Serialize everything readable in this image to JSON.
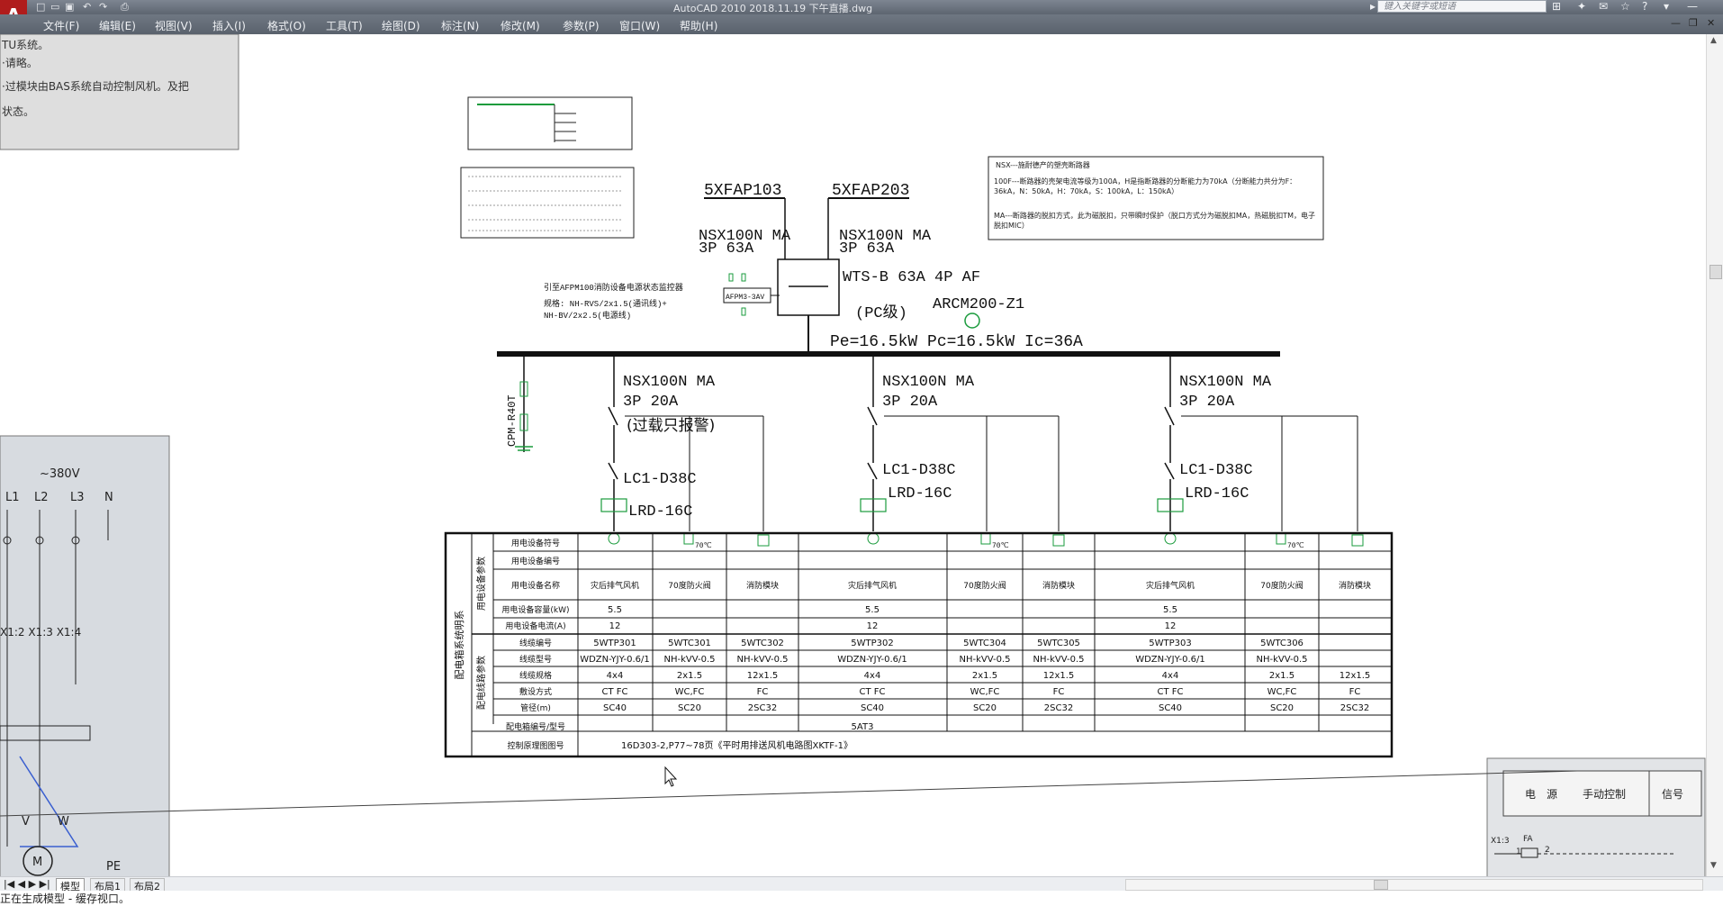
{
  "app": {
    "logo": "A",
    "title": "AutoCAD 2010    2018.11.19 下午直播.dwg",
    "search_placeholder": "键入关键字或短语",
    "quick_access": [
      "□",
      "▭",
      "▣",
      "↶",
      "↷",
      "⎙"
    ]
  },
  "menu": [
    "文件(F)",
    "编辑(E)",
    "视图(V)",
    "插入(I)",
    "格式(O)",
    "工具(T)",
    "绘图(D)",
    "标注(N)",
    "修改(M)",
    "参数(P)",
    "窗口(W)",
    "帮助(H)"
  ],
  "overlay_topleft": [
    "TU系统。",
    "·请略。",
    "·过模块由BAS系统自动控制风机。及把",
    "状态。"
  ],
  "overlay_left": {
    "voltage": "~380V",
    "phases": [
      "L1",
      "L2",
      "L3",
      "N"
    ],
    "terminals": "X1:2 X1:3 X1:4",
    "motor": "M",
    "labels": [
      "V",
      "W",
      "PE"
    ]
  },
  "overlay_bottomright": {
    "headers": [
      "电　源",
      "手动控制",
      "信号"
    ],
    "labels": [
      "X1:3",
      "FA",
      "1",
      "2"
    ]
  },
  "schematic": {
    "sources": [
      "5XFAP103",
      "5XFAP203"
    ],
    "breakers_top": [
      "NSX100N MA",
      "3P 63A"
    ],
    "ats": "WTS-B 63A 4P AF",
    "pc_level": "(PC级)",
    "meter": "ARCM200-Z1",
    "power": "Pe=16.5kW  Pc=16.5kW  Ic=36A",
    "afpm_note": [
      "引至AFPM100消防设备电源状态监控器",
      "规格: NH-RVS/2x1.5(通讯线)+",
      "NH-BV/2x2.5(电源线)"
    ],
    "afpm_box": "AFPM3-3AV",
    "surge": "CPM-R40T",
    "branch_breaker": [
      "NSX100N MA",
      "3P 20A"
    ],
    "alarm_note": "(过载只报警)",
    "contactor": "LC1-D38C",
    "relay": "LRD-16C",
    "temp_tag": "70℃",
    "nsx_note": {
      "line1": "NSX---施耐德产的塑壳断路器",
      "line2": "100F---断路器的壳架电流等级为100A，H是指断路器的分断能力为70kA（分断能力共分为F：36kA，N：50kA，H：70kA，S：100kA，L：150kA）",
      "line3": "MA---断路器的脱扣方式，此为磁脱扣，只带瞬时保护（脱口方式分为磁脱扣MA，热磁脱扣TM，电子脱扣MIC）"
    }
  },
  "table": {
    "side_title": "配电箱系统明系",
    "group1": "用电设备参数",
    "group2": "配电线路参数",
    "row_labels": [
      "用电设备符号",
      "用电设备编号",
      "用电设备名称",
      "用电设备容量(kW)",
      "用电设备电流(A)",
      "线缆编号",
      "线缆型号",
      "线缆规格",
      "敷设方式",
      "管径(m)",
      "配电箱编号/型号",
      "控制原理图图号"
    ],
    "columns": [
      {
        "name": "灾后排气风机",
        "kw": "5.5",
        "a": "12",
        "cable_no": "5WTP301",
        "cable_type": "WDZN-YJY-0.6/1",
        "spec": "4x4",
        "lay": "CT FC",
        "pipe": "SC40"
      },
      {
        "name": "70度防火阀",
        "kw": "",
        "a": "",
        "cable_no": "5WTC301",
        "cable_type": "NH-kVV-0.5",
        "spec": "2x1.5",
        "lay": "WC,FC",
        "pipe": "SC20"
      },
      {
        "name": "消防模块",
        "kw": "",
        "a": "",
        "cable_no": "5WTC302",
        "cable_type": "NH-kVV-0.5",
        "spec": "12x1.5",
        "lay": "FC",
        "pipe": "2SC32"
      },
      {
        "name": "灾后排气风机",
        "kw": "5.5",
        "a": "12",
        "cable_no": "5WTP302",
        "cable_type": "WDZN-YJY-0.6/1",
        "spec": "4x4",
        "lay": "CT FC",
        "pipe": "SC40"
      },
      {
        "name": "70度防火阀",
        "kw": "",
        "a": "",
        "cable_no": "5WTC304",
        "cable_type": "NH-kVV-0.5",
        "spec": "2x1.5",
        "lay": "WC,FC",
        "pipe": "SC20"
      },
      {
        "name": "消防模块",
        "kw": "",
        "a": "",
        "cable_no": "5WTC305",
        "cable_type": "NH-kVV-0.5",
        "spec": "12x1.5",
        "lay": "FC",
        "pipe": "2SC32"
      },
      {
        "name": "灾后排气风机",
        "kw": "5.5",
        "a": "12",
        "cable_no": "5WTP303",
        "cable_type": "WDZN-YJY-0.6/1",
        "spec": "4x4",
        "lay": "CT FC",
        "pipe": "SC40"
      },
      {
        "name": "70度防火阀",
        "kw": "",
        "a": "",
        "cable_no": "5WTC306",
        "cable_type": "NH-kVV-0.5",
        "spec": "2x1.5",
        "lay": "WC,FC",
        "pipe": "SC20"
      },
      {
        "name": "消防模块",
        "kw": "",
        "a": "",
        "cable_no": "",
        "cable_type": "",
        "spec": "12x1.5",
        "lay": "FC",
        "pipe": "2SC32"
      }
    ],
    "box_no": "5AT3",
    "control_ref": "16D303-2,P77~78页《平时用排送风机电路图XKTF-1》"
  },
  "tabs": [
    "模型",
    "布局1",
    "布局2"
  ],
  "cmdline": "正在生成模型 - 缓存视口。",
  "colors": {
    "green": "#1a9b3c",
    "chrome": "#646c77",
    "line": "#111111"
  }
}
